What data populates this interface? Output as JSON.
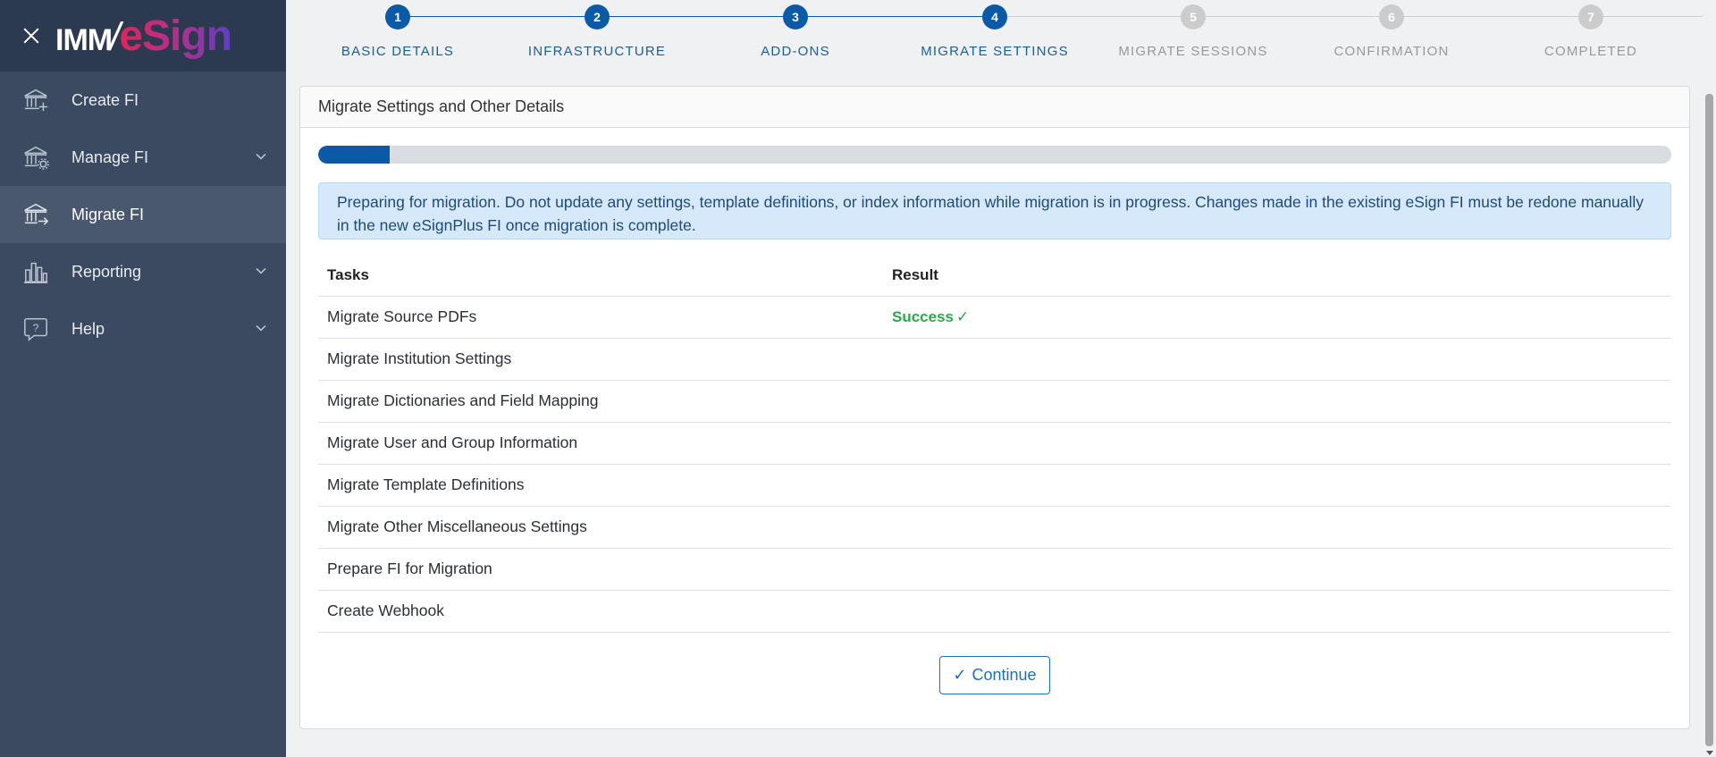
{
  "sidebar": {
    "logo": {
      "part1": "IMM",
      "part2": "/",
      "part3": "eSign"
    },
    "items": [
      {
        "label": "Create FI",
        "icon": "bank-add-icon",
        "active": false,
        "expandable": false
      },
      {
        "label": "Manage FI",
        "icon": "bank-gear-icon",
        "active": false,
        "expandable": true
      },
      {
        "label": "Migrate FI",
        "icon": "bank-arrow-icon",
        "active": true,
        "expandable": false
      },
      {
        "label": "Reporting",
        "icon": "bar-chart-icon",
        "active": false,
        "expandable": true
      },
      {
        "label": "Help",
        "icon": "help-bubble-icon",
        "active": false,
        "expandable": true
      }
    ]
  },
  "stepper": {
    "colors": {
      "complete": "#0a5aa8",
      "pending": "#cccccc",
      "complete_text": "#1d5e99",
      "pending_text": "#999999"
    },
    "steps": [
      {
        "number": "1",
        "label": "BASIC DETAILS",
        "state": "complete"
      },
      {
        "number": "2",
        "label": "INFRASTRUCTURE",
        "state": "complete"
      },
      {
        "number": "3",
        "label": "ADD-ONS",
        "state": "complete"
      },
      {
        "number": "4",
        "label": "MIGRATE SETTINGS",
        "state": "current"
      },
      {
        "number": "5",
        "label": "MIGRATE SESSIONS",
        "state": "pending"
      },
      {
        "number": "6",
        "label": "CONFIRMATION",
        "state": "pending"
      },
      {
        "number": "7",
        "label": "COMPLETED",
        "state": "pending"
      }
    ]
  },
  "card": {
    "title": "Migrate Settings and Other Details",
    "progress_percent": 5.3,
    "alert": "Preparing for migration. Do not update any settings, template definitions, or index information while migration is in progress. Changes made in the existing eSign FI must be redone manually in the new eSignPlus FI once migration is complete.",
    "table": {
      "headers": {
        "tasks": "Tasks",
        "result": "Result"
      },
      "rows": [
        {
          "task": "Migrate Source PDFs",
          "result": "Success",
          "result_icon": "check-icon"
        },
        {
          "task": "Migrate Institution Settings",
          "result": ""
        },
        {
          "task": "Migrate Dictionaries and Field Mapping",
          "result": ""
        },
        {
          "task": "Migrate User and Group Information",
          "result": ""
        },
        {
          "task": "Migrate Template Definitions",
          "result": ""
        },
        {
          "task": "Migrate Other Miscellaneous Settings",
          "result": ""
        },
        {
          "task": "Prepare FI for Migration",
          "result": ""
        },
        {
          "task": "Create Webhook",
          "result": ""
        }
      ]
    },
    "continue_label": "Continue"
  }
}
